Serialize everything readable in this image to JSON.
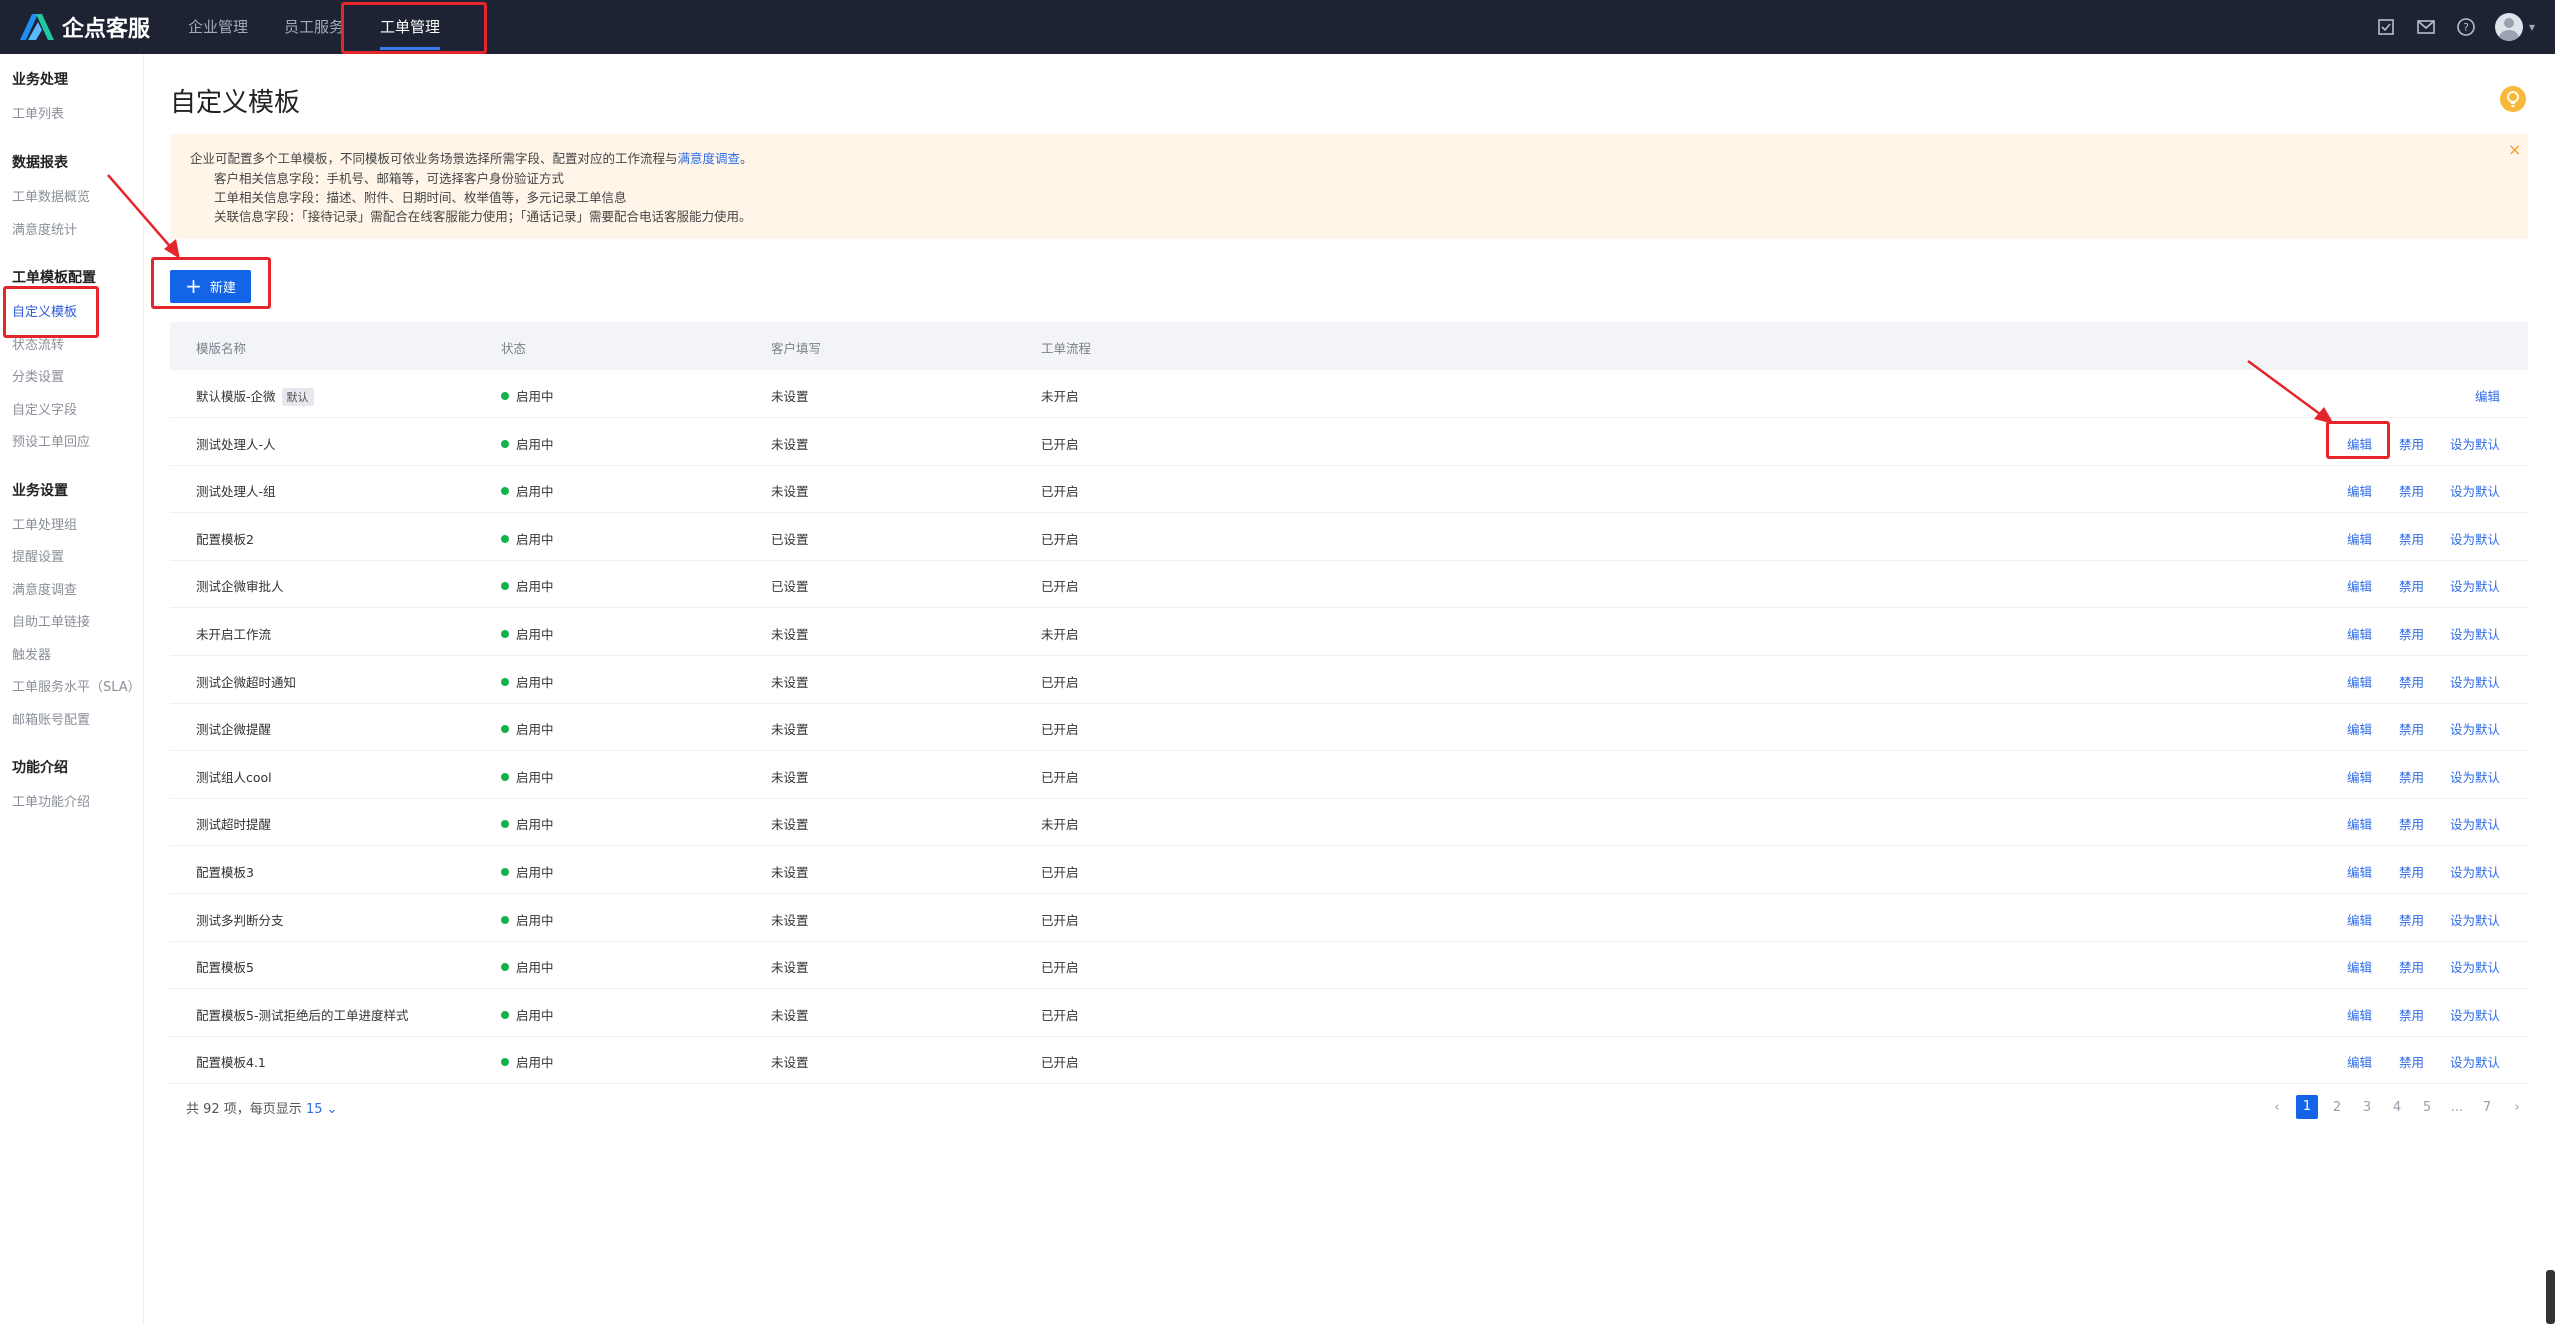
{
  "app": {
    "name": "企点客服"
  },
  "topnav": [
    {
      "label": "企业管理"
    },
    {
      "label": "员工服务"
    },
    {
      "label": "工单管理",
      "active": true
    }
  ],
  "sidebar": {
    "groups": [
      {
        "title": "业务处理",
        "items": [
          "工单列表"
        ]
      },
      {
        "title": "数据报表",
        "items": [
          "工单数据概览",
          "满意度统计"
        ]
      },
      {
        "title": "工单模板配置",
        "items": [
          "自定义模板",
          "状态流转",
          "分类设置",
          "自定义字段",
          "预设工单回应"
        ]
      },
      {
        "title": "业务设置",
        "items": [
          "工单处理组",
          "提醒设置",
          "满意度调查",
          "自助工单链接",
          "触发器",
          "工单服务水平（SLA）",
          "邮箱账号配置"
        ]
      },
      {
        "title": "功能介绍",
        "items": [
          "工单功能介绍"
        ]
      }
    ],
    "active_item": "自定义模板"
  },
  "page": {
    "title": "自定义模板"
  },
  "notice": {
    "line1_prefix": "企业可配置多个工单模板，不同模板可依业务场景选择所需字段、配置对应的工作流程与",
    "line1_link": "满意度调查",
    "line1_suffix": "。",
    "line2": "客户相关信息字段：手机号、邮箱等，可选择客户身份验证方式",
    "line3": "工单相关信息字段：描述、附件、日期时间、枚举值等，多元记录工单信息",
    "line4": "关联信息字段：「接待记录」需配合在线客服能力使用；「通话记录」需要配合电话客服能力使用。",
    "close": "×"
  },
  "toolbar": {
    "new_label": "新建"
  },
  "table": {
    "headers": [
      "模版名称",
      "状态",
      "客户填写",
      "工单流程"
    ],
    "actions": {
      "edit": "编辑",
      "disable": "禁用",
      "set_default": "设为默认"
    },
    "default_tag": "默认",
    "rows": [
      {
        "name": "默认模版-企微",
        "status": "启用中",
        "customer": "未设置",
        "flow": "未开启",
        "is_default": true
      },
      {
        "name": "测试处理人-人",
        "status": "启用中",
        "customer": "未设置",
        "flow": "已开启"
      },
      {
        "name": "测试处理人-组",
        "status": "启用中",
        "customer": "未设置",
        "flow": "已开启"
      },
      {
        "name": "配置模板2",
        "status": "启用中",
        "customer": "已设置",
        "flow": "已开启"
      },
      {
        "name": "测试企微审批人",
        "status": "启用中",
        "customer": "已设置",
        "flow": "已开启"
      },
      {
        "name": "未开启工作流",
        "status": "启用中",
        "customer": "未设置",
        "flow": "未开启"
      },
      {
        "name": "测试企微超时通知",
        "status": "启用中",
        "customer": "未设置",
        "flow": "已开启"
      },
      {
        "name": "测试企微提醒",
        "status": "启用中",
        "customer": "未设置",
        "flow": "已开启"
      },
      {
        "name": "测试组人cool",
        "status": "启用中",
        "customer": "未设置",
        "flow": "已开启"
      },
      {
        "name": "测试超时提醒",
        "status": "启用中",
        "customer": "未设置",
        "flow": "未开启"
      },
      {
        "name": "配置模板3",
        "status": "启用中",
        "customer": "未设置",
        "flow": "已开启"
      },
      {
        "name": "测试多判断分支",
        "status": "启用中",
        "customer": "未设置",
        "flow": "已开启"
      },
      {
        "name": "配置模板5",
        "status": "启用中",
        "customer": "未设置",
        "flow": "已开启"
      },
      {
        "name": "配置模板5-测试拒绝后的工单进度样式",
        "status": "启用中",
        "customer": "未设置",
        "flow": "已开启"
      },
      {
        "name": "配置模板4.1",
        "status": "启用中",
        "customer": "未设置",
        "flow": "已开启"
      }
    ]
  },
  "footer": {
    "total_text": "共 92 项，每页显示",
    "page_size": "15"
  },
  "pagination": {
    "pages": [
      "1",
      "2",
      "3",
      "4",
      "5",
      "...",
      "7"
    ],
    "current": "1",
    "prev": "‹",
    "next": "›"
  },
  "colors": {
    "topbar": "#1d2333",
    "primary": "#1464e8",
    "link": "#2e6be6",
    "status_green": "#12b24a",
    "annotation_red": "#e4262c"
  }
}
